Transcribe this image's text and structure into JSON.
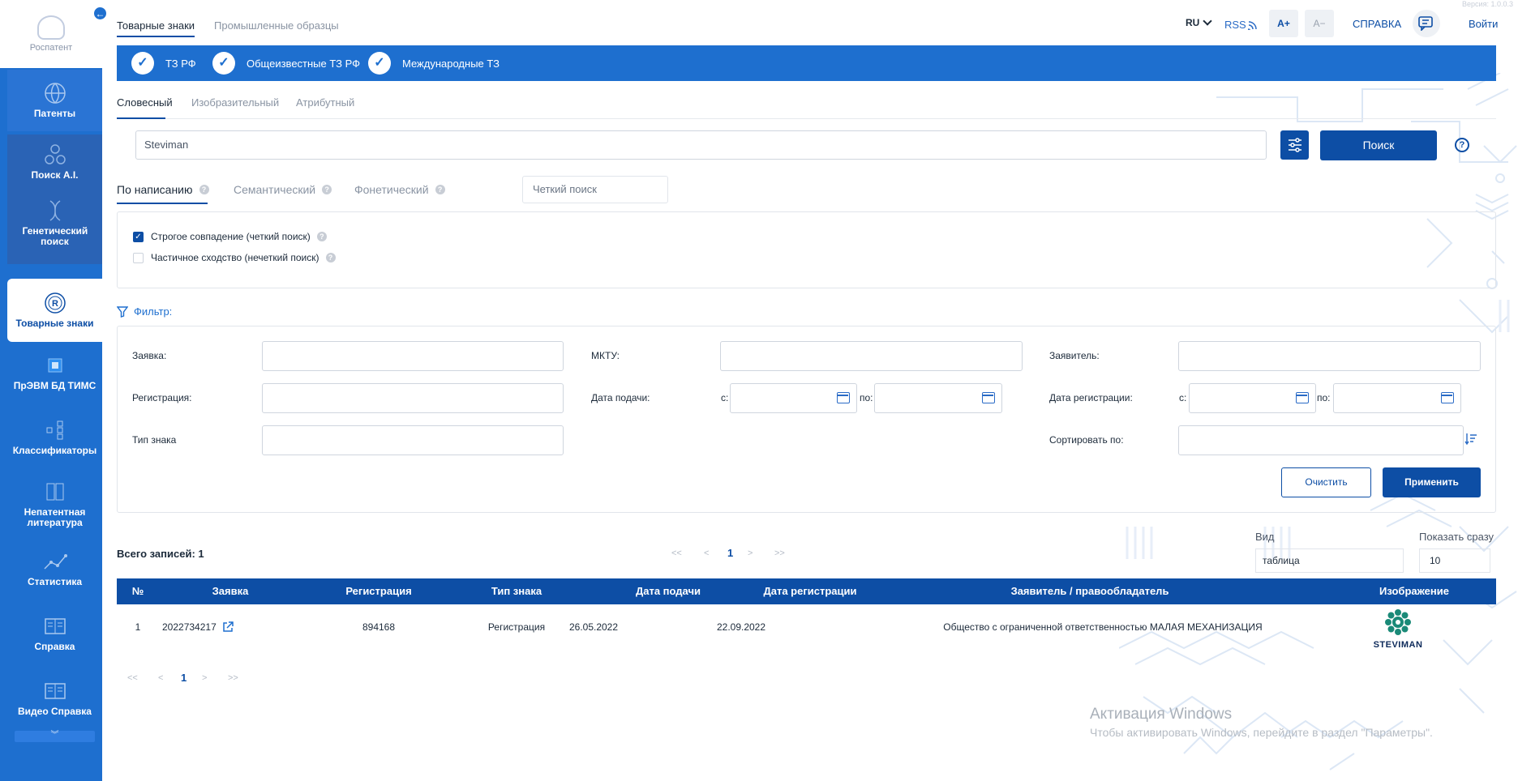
{
  "sidebar": {
    "logo_text": "Роспатент",
    "items": [
      {
        "label": "Патенты",
        "icon": "globe-icon"
      },
      {
        "label": "Поиск A.I.",
        "icon": "ai-network-icon"
      },
      {
        "label": "Генетический поиск",
        "icon": "dna-icon"
      },
      {
        "label": "Товарные знаки",
        "icon": "registered-mark-icon"
      },
      {
        "label": "ПрЭВМ БД ТИМС",
        "icon": "chip-icon"
      },
      {
        "label": "Классификаторы",
        "icon": "hierarchy-icon"
      },
      {
        "label": "Непатентная литература",
        "icon": "books-icon"
      },
      {
        "label": "Статистика",
        "icon": "chart-line-icon"
      },
      {
        "label": "Справка",
        "icon": "book-icon"
      },
      {
        "label": "Видео Справка",
        "icon": "video-book-icon"
      }
    ]
  },
  "header": {
    "tabs": [
      "Товарные знаки",
      "Промышленные образцы"
    ],
    "lang": "RU",
    "rss": "RSS",
    "font_plus": "A+",
    "font_minus": "A−",
    "help": "СПРАВКА",
    "login": "Войти",
    "version": "Версия: 1.0.0.3"
  },
  "databases": [
    "ТЗ РФ",
    "Общеизвестные ТЗ РФ",
    "Международные ТЗ"
  ],
  "search_types": [
    "Словесный",
    "Изобразительный",
    "Атрибутный"
  ],
  "query": "Steviman",
  "search_button": "Поиск",
  "modes": [
    "По написанию",
    "Семантический",
    "Фонетический"
  ],
  "exact_search_placeholder": "Четкий поиск",
  "options": [
    {
      "label": "Строгое совпадение (четкий поиск)",
      "checked": true
    },
    {
      "label": "Частичное сходство (нечеткий поиск)",
      "checked": false
    }
  ],
  "filter": {
    "title": "Фильтр:",
    "application": "Заявка:",
    "mktu": "МКТУ:",
    "applicant": "Заявитель:",
    "registration": "Регистрация:",
    "filing_date": "Дата подачи:",
    "reg_date": "Дата регистрации:",
    "from": "с:",
    "to": "по:",
    "mark_type": "Тип знака",
    "sort_by": "Сортировать по:",
    "clear": "Очистить",
    "apply": "Применить"
  },
  "results": {
    "total": "Всего записей: 1",
    "pager": {
      "first": "<<",
      "prev": "<",
      "page": "1",
      "next": ">",
      "last": ">>"
    },
    "view_label": "Вид",
    "view_value": "таблица",
    "show_label": "Показать сразу",
    "show_value": "10",
    "columns": [
      "№",
      "Заявка",
      "Регистрация",
      "Тип знака",
      "Дата подачи",
      "Дата регистрации",
      "Заявитель / правообладатель",
      "Изображение"
    ],
    "rows": [
      {
        "num": "1",
        "application": "2022734217",
        "registration": "894168",
        "type": "Регистрация",
        "filed": "26.05.2022",
        "registered": "22.09.2022",
        "owner": "Общество с ограниченной ответственностью МАЛАЯ МЕХАНИЗАЦИЯ",
        "image_text": "STEVIMAN"
      }
    ]
  },
  "watermark": {
    "line1": "Активация Windows",
    "line2": "Чтобы активировать Windows, перейдите в раздел \"Параметры\"."
  },
  "colors": {
    "primary": "#0d4ea5",
    "bar": "#1e6fcf",
    "logo_green": "#1a8a78"
  }
}
